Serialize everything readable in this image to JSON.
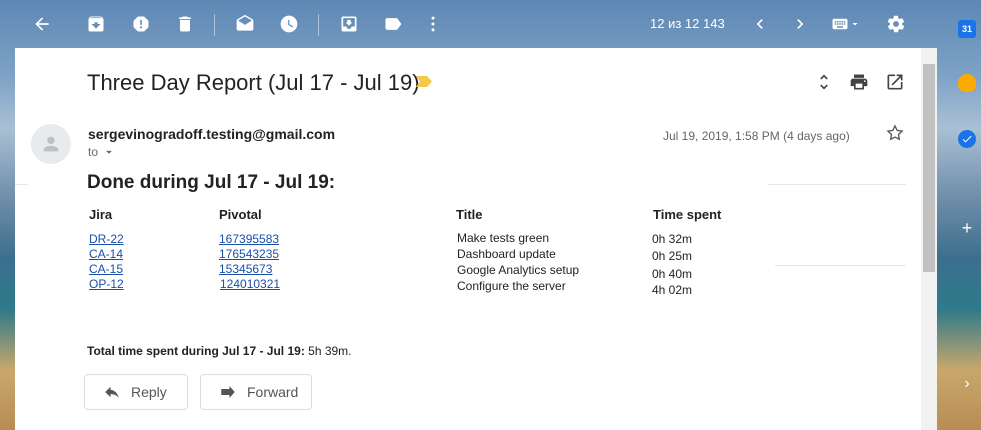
{
  "toolbar": {
    "back_icon": "arrow-left-icon",
    "archive_icon": "archive-icon",
    "spam_icon": "report-spam-icon",
    "delete_icon": "trash-icon",
    "unread_icon": "mark-unread-icon",
    "snooze_icon": "clock-icon",
    "move_icon": "move-to-inbox-icon",
    "label_icon": "label-icon",
    "more_icon": "more-vert-icon",
    "counter": "12 из 12 143",
    "prev_icon": "chevron-left-icon",
    "next_icon": "chevron-right-icon",
    "input_tools_icon": "keyboard-icon",
    "settings_icon": "gear-icon"
  },
  "email": {
    "subject": "Three Day Report (Jul 17 - Jul 19)",
    "sender": "sergevinogradoff.testing@gmail.com",
    "to_label": "to",
    "date": "Jul 19, 2019, 1:58 PM (4 days ago)",
    "report_title": "Done during Jul 17 - Jul 19:",
    "columns": [
      "Jira",
      "Pivotal",
      "Title",
      "Time spent"
    ],
    "rows": [
      {
        "jira": "DR-22",
        "pivotal": "167395583",
        "title": "Make tests green",
        "time": "0h 32m"
      },
      {
        "jira": "CA-14",
        "pivotal": "176543235",
        "title": "Dashboard update",
        "time": "0h 25m"
      },
      {
        "jira": "CA-15",
        "pivotal": "15345673",
        "title": "Google Analytics setup",
        "time": "0h 40m"
      },
      {
        "jira": "OP-12",
        "pivotal": "124010321",
        "title": "Configure the server",
        "time": "4h 02m"
      }
    ],
    "total_label": "Total time spent during Jul 17 - Jul 19:",
    "total_value": "5h 39m."
  },
  "actions": {
    "reply": "Reply",
    "forward": "Forward"
  },
  "side_panel": {
    "calendar_day": "31"
  },
  "colors": {
    "link": "#1a4fa8",
    "importance": "#f2c94c"
  }
}
